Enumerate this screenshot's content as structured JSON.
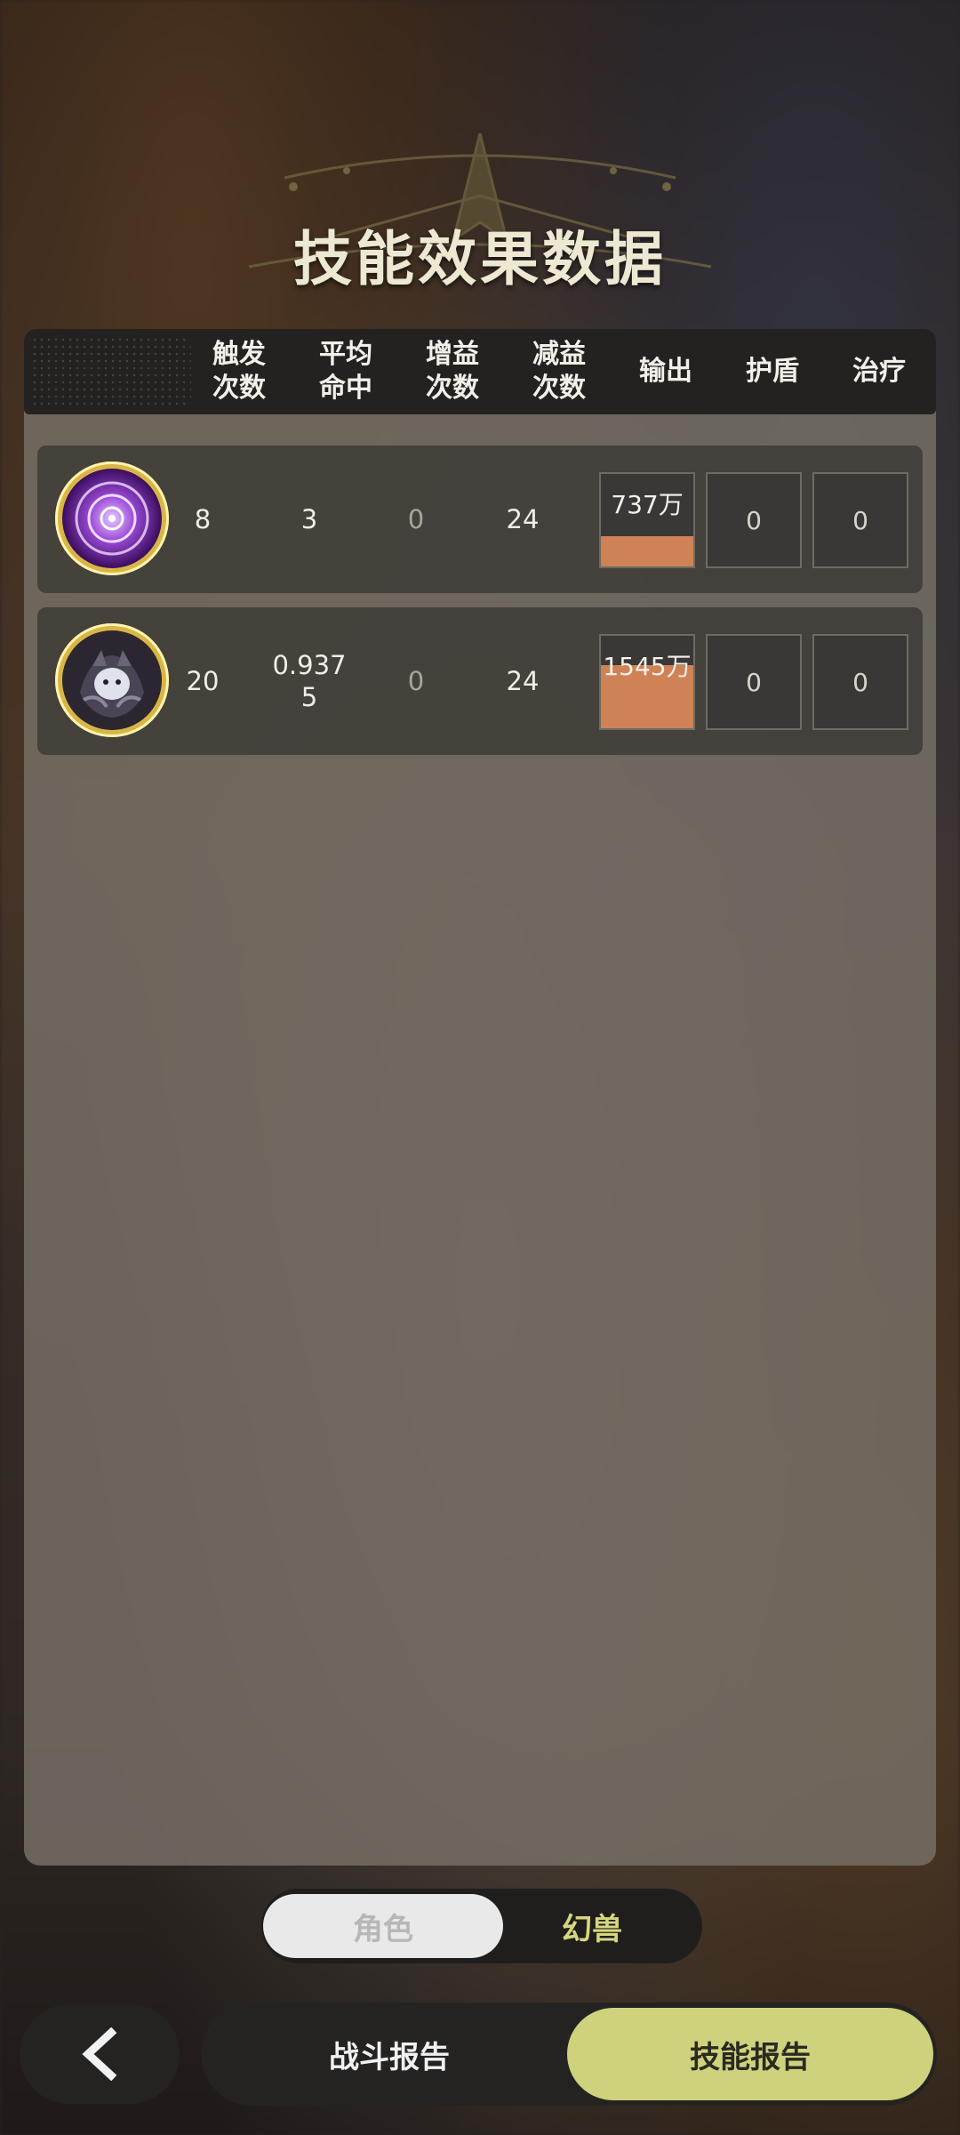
{
  "title": "技能效果数据",
  "columns": [
    {
      "line1": "触发",
      "line2": "次数"
    },
    {
      "line1": "平均",
      "line2": "命中"
    },
    {
      "line1": "增益",
      "line2": "次数"
    },
    {
      "line1": "减益",
      "line2": "次数"
    },
    {
      "line1": "输出",
      "line2": ""
    },
    {
      "line1": "护盾",
      "line2": ""
    },
    {
      "line1": "治疗",
      "line2": ""
    }
  ],
  "rows": [
    {
      "icon": "purple-vortex-icon",
      "trigger": "8",
      "avg_hit": "3",
      "buff": "0",
      "debuff": "24",
      "output": "737万",
      "output_fill": 0.33,
      "shield": "0",
      "heal": "0"
    },
    {
      "icon": "shadow-beast-icon",
      "trigger": "20",
      "avg_hit_1": "0.937",
      "avg_hit_2": "5",
      "buff": "0",
      "debuff": "24",
      "output": "1545万",
      "output_fill": 0.68,
      "shield": "0",
      "heal": "0"
    }
  ],
  "toggle": {
    "left": "角色",
    "right": "幻兽",
    "selected": "幻兽"
  },
  "nav": {
    "back": "back-arrow-icon",
    "battle_report": "战斗报告",
    "skill_report": "技能报告"
  },
  "colors": {
    "accent": "#cfd27c",
    "output_bar": "#cf8256",
    "title": "#ece8d2"
  }
}
